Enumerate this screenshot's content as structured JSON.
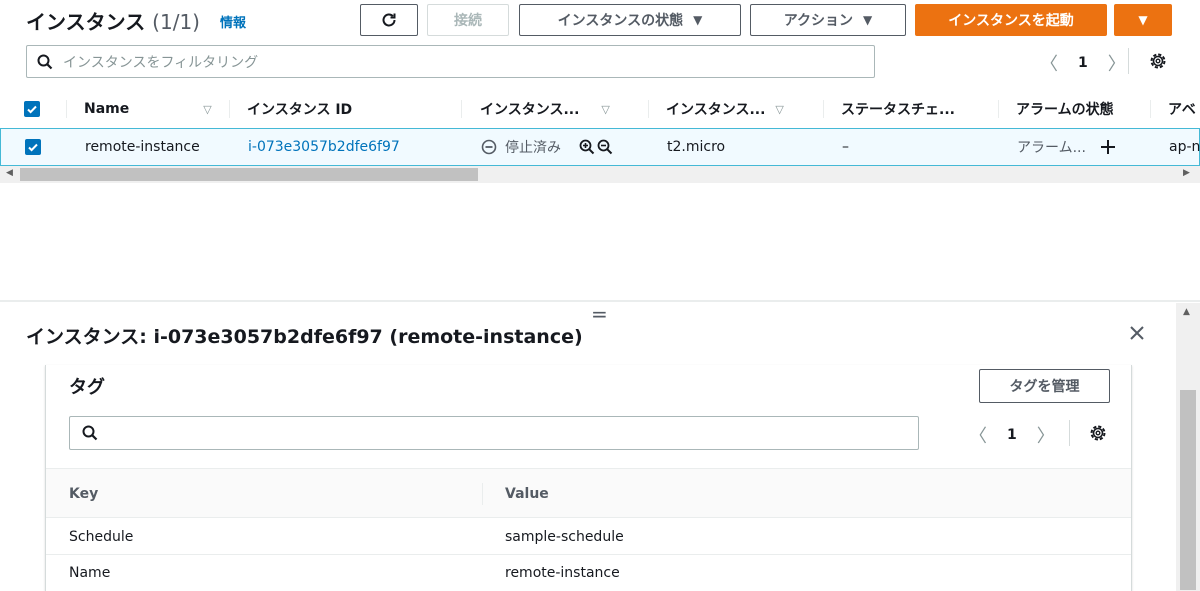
{
  "header": {
    "title": "インスタンス",
    "count": "(1/1)",
    "info_link": "情報",
    "connect_button": "接続",
    "instance_state_button": "インスタンスの状態",
    "actions_button": "アクション",
    "launch_button": "インスタンスを起動"
  },
  "filter": {
    "placeholder": "インスタンスをフィルタリング",
    "page": "1"
  },
  "table": {
    "columns": [
      "Name",
      "インスタンス ID",
      "インスタンス...",
      "インスタンス...",
      "ステータスチェ...",
      "アラームの状態",
      "アベ"
    ],
    "rows": [
      {
        "name": "remote-instance",
        "instance_id": "i-073e3057b2dfe6f97",
        "state": "停止済み",
        "type": "t2.micro",
        "status_check": "–",
        "alarm": "アラーム...",
        "az": "ap-n"
      }
    ]
  },
  "detail": {
    "title": "インスタンス: i-073e3057b2dfe6f97 (remote-instance)",
    "tags_section": {
      "title": "タグ",
      "manage_button": "タグを管理",
      "page": "1",
      "columns": [
        "Key",
        "Value"
      ],
      "rows": [
        {
          "key": "Schedule",
          "value": "sample-schedule"
        },
        {
          "key": "Name",
          "value": "remote-instance"
        }
      ]
    }
  },
  "colors": {
    "primary": "#ec7211",
    "link": "#0073bb",
    "selected_row_bg": "#f1faff",
    "selected_row_border": "#44b9d6"
  }
}
